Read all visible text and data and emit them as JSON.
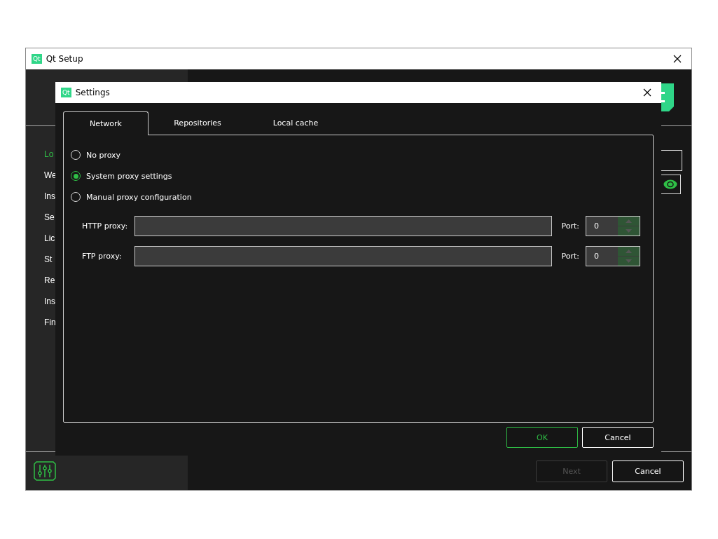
{
  "main_window": {
    "logo": "Qt",
    "title": "Qt Setup",
    "sidebar": {
      "items": [
        {
          "label": "Lo",
          "selected": true
        },
        {
          "label": "We",
          "selected": false
        },
        {
          "label": "Ins",
          "selected": false
        },
        {
          "label": "Se",
          "selected": false
        },
        {
          "label": "Lic",
          "selected": false
        },
        {
          "label": "St",
          "selected": false
        },
        {
          "label": "Re",
          "selected": false
        },
        {
          "label": "Ins",
          "selected": false
        },
        {
          "label": "Fin",
          "selected": false
        }
      ]
    },
    "buttons": [
      {
        "label": "Next",
        "disabled": true
      },
      {
        "label": "Cancel",
        "disabled": false
      }
    ]
  },
  "dialog": {
    "logo": "Qt",
    "title": "Settings",
    "tabs": [
      {
        "label": "Network",
        "selected": true
      },
      {
        "label": "Repositories",
        "selected": false
      },
      {
        "label": "Local cache",
        "selected": false
      }
    ],
    "proxy_options": [
      {
        "label": "No proxy",
        "selected": false
      },
      {
        "label": "System proxy settings",
        "selected": true
      },
      {
        "label": "Manual proxy configuration",
        "selected": false
      }
    ],
    "proxy_fields": [
      {
        "label": "HTTP proxy:",
        "port_label": "Port:",
        "port": "0"
      },
      {
        "label": "FTP proxy:",
        "port_label": "Port:",
        "port": "0"
      }
    ],
    "buttons": [
      {
        "label": "OK",
        "kind": "default"
      },
      {
        "label": "Cancel",
        "kind": "normal"
      }
    ]
  }
}
